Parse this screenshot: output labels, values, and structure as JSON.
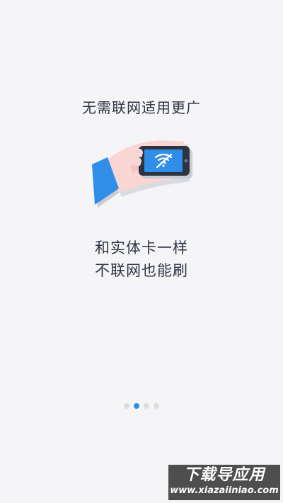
{
  "onboarding": {
    "headline": "无需联网适用更广",
    "body_line1": "和实体卡一样",
    "body_line2": "不联网也能刷",
    "illustration_icon": "hand-holding-phone-no-wifi-icon",
    "pager": {
      "total": 4,
      "active_index": 1
    }
  },
  "watermark": {
    "title": "下载导应用",
    "url": "www.xiazaiiniao.com"
  },
  "colors": {
    "background": "#f5f5f7",
    "text": "#2e3342",
    "accent": "#2f8fe8",
    "dot_inactive": "#dcdcdc",
    "sleeve": "#2f8fe8",
    "hand": "#f9d5d3",
    "phone": "#2d3340",
    "screen": "#2f8fe8"
  }
}
